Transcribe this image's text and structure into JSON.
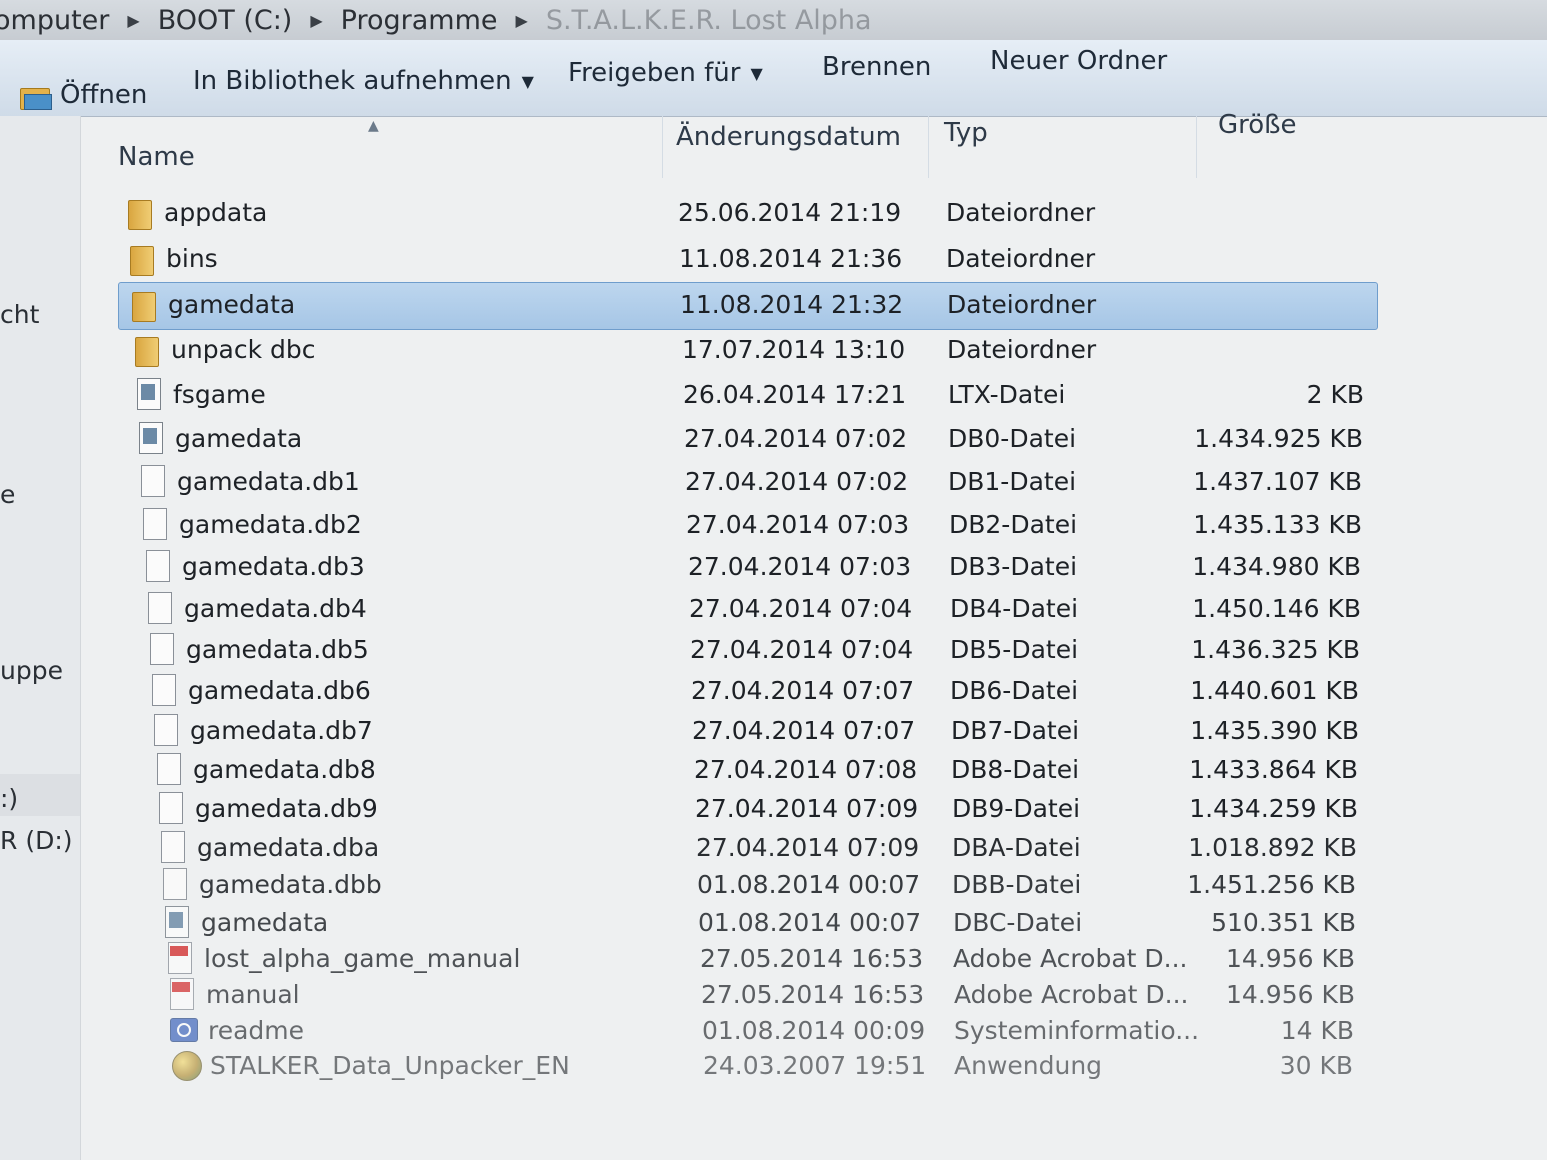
{
  "breadcrumb": {
    "items": [
      "omputer",
      "BOOT (C:)",
      "Programme",
      "S.T.A.L.K.E.R. Lost Alpha"
    ]
  },
  "toolbar": {
    "open_label": "Öffnen",
    "library_label": "In Bibliothek aufnehmen",
    "share_label": "Freigeben für",
    "burn_label": "Brennen",
    "new_folder_label": "Neuer Ordner"
  },
  "navpane": {
    "items": [
      "cht",
      "e",
      "uppe",
      ":)",
      "R (D:)"
    ]
  },
  "columns": {
    "name": "Name",
    "date": "Änderungsdatum",
    "type": "Typ",
    "size": "Größe"
  },
  "files": [
    {
      "name": "appdata",
      "date": "25.06.2014 21:19",
      "type": "Dateiordner",
      "size": "",
      "icon": "folder-icon"
    },
    {
      "name": "bins",
      "date": "11.08.2014 21:36",
      "type": "Dateiordner",
      "size": "",
      "icon": "folder-icon"
    },
    {
      "name": "gamedata",
      "date": "11.08.2014 21:32",
      "type": "Dateiordner",
      "size": "",
      "icon": "folder-icon",
      "selected": true
    },
    {
      "name": "unpack dbc",
      "date": "17.07.2014 13:10",
      "type": "Dateiordner",
      "size": "",
      "icon": "folder-icon"
    },
    {
      "name": "fsgame",
      "date": "26.04.2014 17:21",
      "type": "LTX-Datei",
      "size": "2 KB",
      "icon": "config-file-icon"
    },
    {
      "name": "gamedata",
      "date": "27.04.2014 07:02",
      "type": "DB0-Datei",
      "size": "1.434.925 KB",
      "icon": "config-file-icon"
    },
    {
      "name": "gamedata.db1",
      "date": "27.04.2014 07:02",
      "type": "DB1-Datei",
      "size": "1.437.107 KB",
      "icon": "file-icon"
    },
    {
      "name": "gamedata.db2",
      "date": "27.04.2014 07:03",
      "type": "DB2-Datei",
      "size": "1.435.133 KB",
      "icon": "file-icon"
    },
    {
      "name": "gamedata.db3",
      "date": "27.04.2014 07:03",
      "type": "DB3-Datei",
      "size": "1.434.980 KB",
      "icon": "file-icon"
    },
    {
      "name": "gamedata.db4",
      "date": "27.04.2014 07:04",
      "type": "DB4-Datei",
      "size": "1.450.146 KB",
      "icon": "file-icon"
    },
    {
      "name": "gamedata.db5",
      "date": "27.04.2014 07:04",
      "type": "DB5-Datei",
      "size": "1.436.325 KB",
      "icon": "file-icon"
    },
    {
      "name": "gamedata.db6",
      "date": "27.04.2014 07:07",
      "type": "DB6-Datei",
      "size": "1.440.601 KB",
      "icon": "file-icon"
    },
    {
      "name": "gamedata.db7",
      "date": "27.04.2014 07:07",
      "type": "DB7-Datei",
      "size": "1.435.390 KB",
      "icon": "file-icon"
    },
    {
      "name": "gamedata.db8",
      "date": "27.04.2014 07:08",
      "type": "DB8-Datei",
      "size": "1.433.864 KB",
      "icon": "file-icon"
    },
    {
      "name": "gamedata.db9",
      "date": "27.04.2014 07:09",
      "type": "DB9-Datei",
      "size": "1.434.259 KB",
      "icon": "file-icon"
    },
    {
      "name": "gamedata.dba",
      "date": "27.04.2014 07:09",
      "type": "DBA-Datei",
      "size": "1.018.892 KB",
      "icon": "file-icon"
    },
    {
      "name": "gamedata.dbb",
      "date": "01.08.2014 00:07",
      "type": "DBB-Datei",
      "size": "1.451.256 KB",
      "icon": "file-icon"
    },
    {
      "name": "gamedata",
      "date": "01.08.2014 00:07",
      "type": "DBC-Datei",
      "size": "510.351 KB",
      "icon": "config-file-icon"
    },
    {
      "name": "lost_alpha_game_manual",
      "date": "27.05.2014 16:53",
      "type": "Adobe Acrobat D...",
      "size": "14.956 KB",
      "icon": "pdf-icon"
    },
    {
      "name": "manual",
      "date": "27.05.2014 16:53",
      "type": "Adobe Acrobat D...",
      "size": "14.956 KB",
      "icon": "pdf-icon"
    },
    {
      "name": "readme",
      "date": "01.08.2014 00:09",
      "type": "Systeminformatio...",
      "size": "14 KB",
      "icon": "system-info-icon"
    },
    {
      "name": "STALKER_Data_Unpacker_EN",
      "date": "24.03.2007 19:51",
      "type": "Anwendung",
      "size": "30 KB",
      "icon": "application-icon"
    }
  ]
}
